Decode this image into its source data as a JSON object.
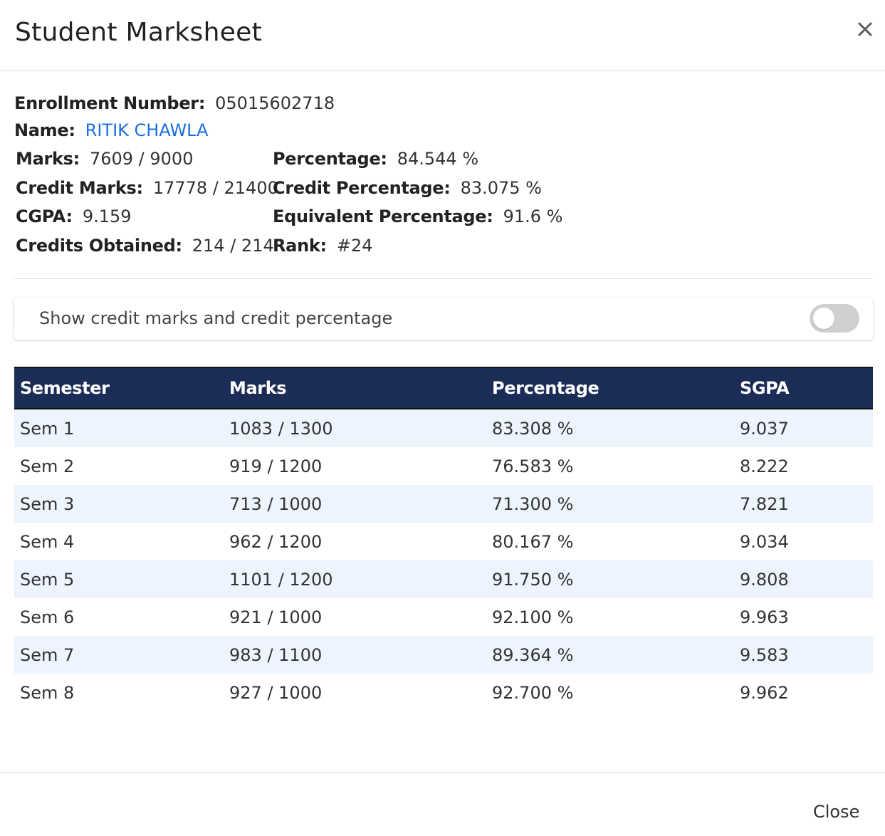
{
  "modal": {
    "title": "Student Marksheet",
    "close_label": "Close"
  },
  "student": {
    "enrollment_label": "Enrollment Number:",
    "enrollment_value": "05015602718",
    "name_label": "Name:",
    "name_value": "RITIK CHAWLA",
    "marks_label": "Marks:",
    "marks_value": "7609 / 9000",
    "percentage_label": "Percentage:",
    "percentage_value": "84.544 %",
    "credit_marks_label": "Credit Marks:",
    "credit_marks_value": "17778 / 21400",
    "credit_percentage_label": "Credit Percentage:",
    "credit_percentage_value": "83.075 %",
    "cgpa_label": "CGPA:",
    "cgpa_value": "9.159",
    "equivalent_percentage_label": "Equivalent Percentage:",
    "equivalent_percentage_value": "91.6 %",
    "credits_obtained_label": "Credits Obtained:",
    "credits_obtained_value": "214 / 214",
    "rank_label": "Rank:",
    "rank_value": "#24"
  },
  "toggle": {
    "label": "Show credit marks and credit percentage",
    "checked": false
  },
  "table": {
    "headers": [
      "Semester",
      "Marks",
      "Percentage",
      "SGPA"
    ],
    "rows": [
      [
        "Sem 1",
        "1083 / 1300",
        "83.308 %",
        "9.037"
      ],
      [
        "Sem 2",
        "919 / 1200",
        "76.583 %",
        "8.222"
      ],
      [
        "Sem 3",
        "713 / 1000",
        "71.300 %",
        "7.821"
      ],
      [
        "Sem 4",
        "962 / 1200",
        "80.167 %",
        "9.034"
      ],
      [
        "Sem 5",
        "1101 / 1200",
        "91.750 %",
        "9.808"
      ],
      [
        "Sem 6",
        "921 / 1000",
        "92.100 %",
        "9.963"
      ],
      [
        "Sem 7",
        "983 / 1100",
        "89.364 %",
        "9.583"
      ],
      [
        "Sem 8",
        "927 / 1000",
        "92.700 %",
        "9.962"
      ]
    ]
  },
  "colors": {
    "header_bg": "#1b2d57",
    "row_stripe": "#edf4fe",
    "link": "#1a6fe0",
    "toggle_off": "#d0d0d0"
  },
  "icons": {
    "close": "close-icon"
  }
}
